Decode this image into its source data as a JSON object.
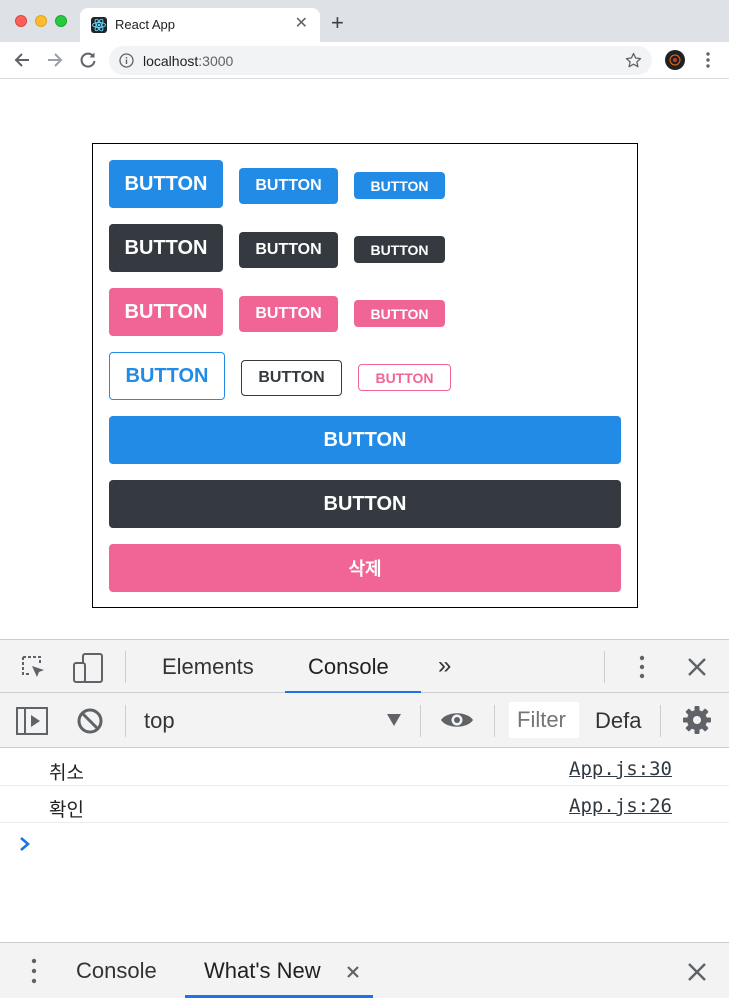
{
  "browser": {
    "tab_title": "React App",
    "url_host": "localhost",
    "url_port": ":3000"
  },
  "buttons": {
    "label": "BUTTON",
    "delete_label": "삭제",
    "colors": {
      "blue": "#228be6",
      "gray": "#343a40",
      "pink": "#f06595"
    }
  },
  "devtools": {
    "tabs": [
      "Elements",
      "Console"
    ],
    "active_tab": "Console",
    "context": "top",
    "filter_placeholder": "Filter",
    "levels_label": "Defa",
    "logs": [
      {
        "message": "취소",
        "source": "App.js:30"
      },
      {
        "message": "확인",
        "source": "App.js:26"
      }
    ],
    "drawer_tabs": [
      "Console",
      "What's New"
    ],
    "active_drawer_tab": "What's New"
  }
}
